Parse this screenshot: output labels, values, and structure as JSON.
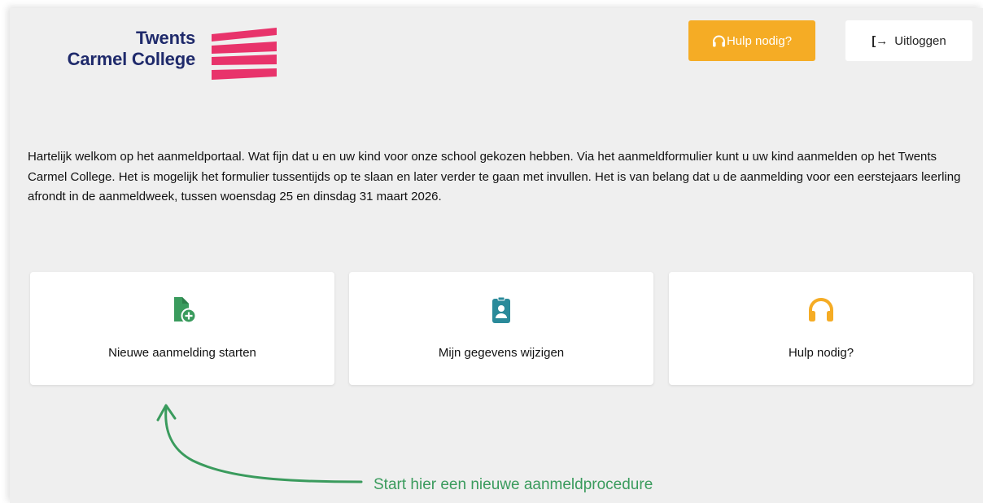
{
  "logo": {
    "line1": "Twents",
    "line2": "Carmel College",
    "brand_color": "#1f2a6b",
    "accent_color": "#e8336b"
  },
  "header": {
    "help_label": "Hulp nodig?",
    "help_icon": "headset-icon",
    "help_color": "#f5ac25",
    "logout_label": "Uitloggen",
    "logout_icon": "logout-arrow-icon"
  },
  "intro": "Hartelijk welkom op het aanmeldportaal. Wat fijn dat u en uw kind voor onze school gekozen hebben. Via het aanmeldformulier kunt u uw kind aanmelden op het Twents Carmel College. Het is mogelijk het formulier tussentijds op te slaan en later verder te gaan met invullen. Het is van belang dat u de aanmelding voor een eerstejaars leerling afrondt in de aanmeldweek, tussen woensdag 25 en dinsdag 31 maart 2026.",
  "cards": [
    {
      "label": "Nieuwe aanmelding starten",
      "icon": "file-add-icon",
      "color": "#3a9b5d"
    },
    {
      "label": "Mijn gegevens wijzigen",
      "icon": "id-badge-icon",
      "color": "#2a8a9a"
    },
    {
      "label": "Hulp nodig?",
      "icon": "headphones-icon",
      "color": "#f5ac25"
    }
  ],
  "annotation": {
    "text": "Start hier een nieuwe aanmeldprocedure",
    "color": "#3a9b5d"
  }
}
